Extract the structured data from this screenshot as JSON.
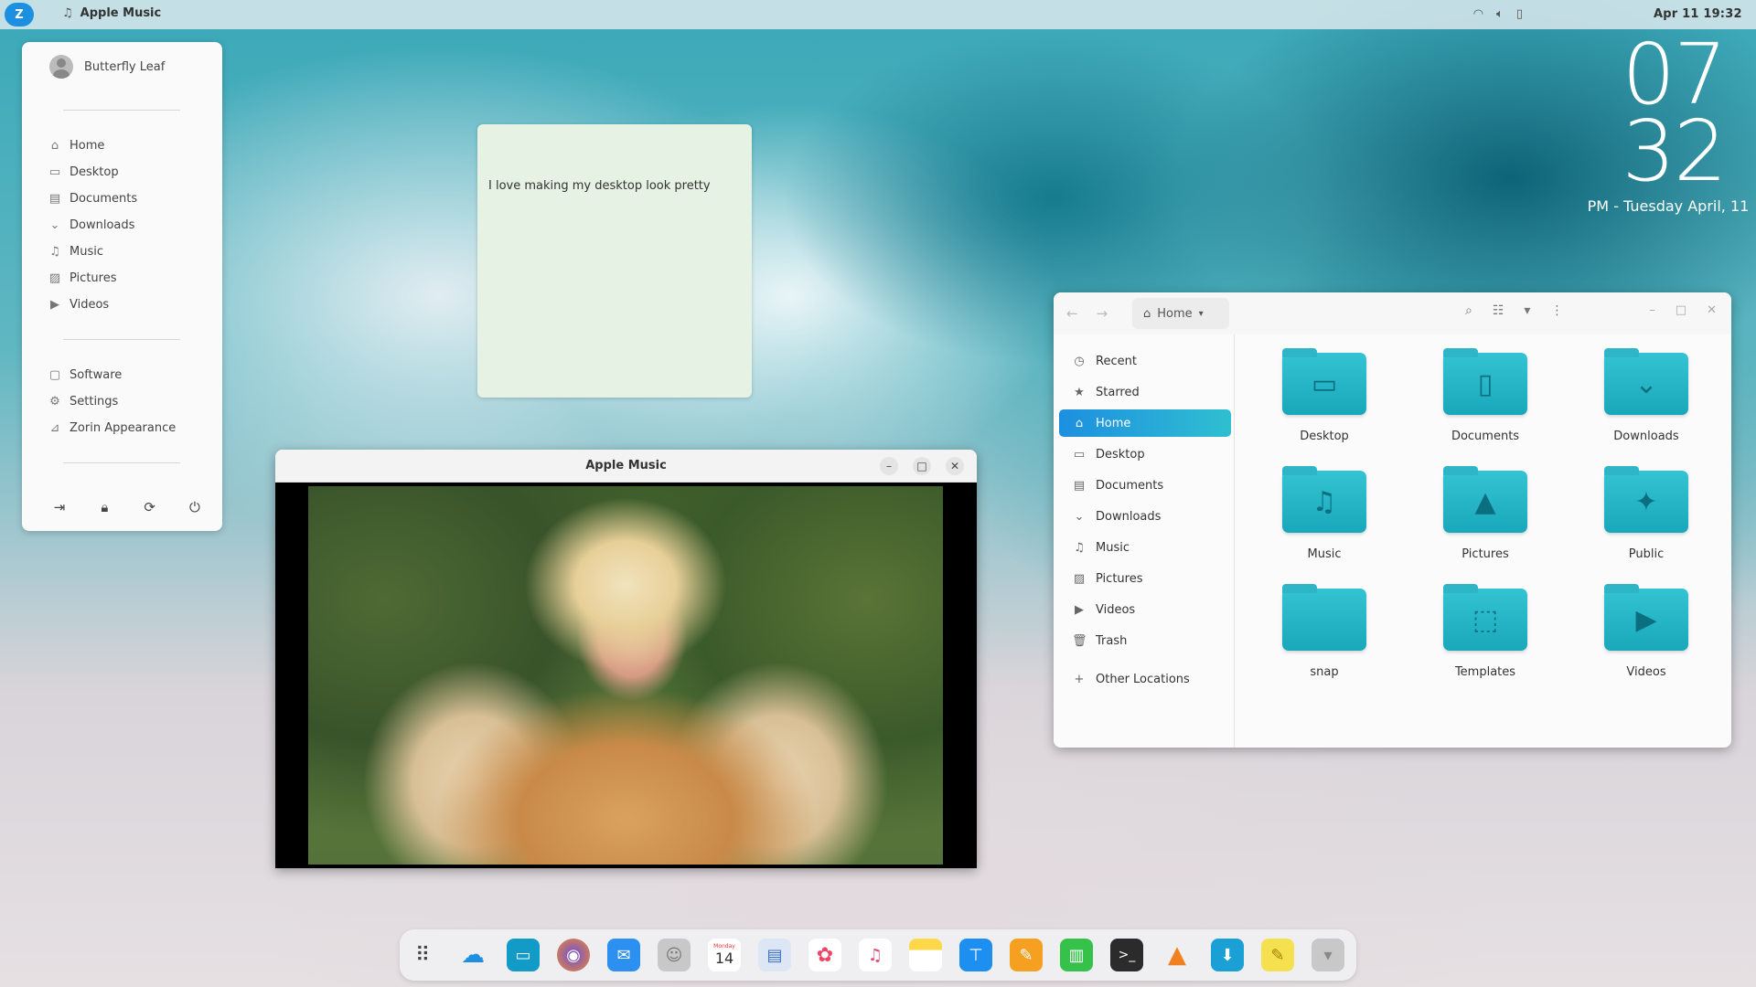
{
  "topbar": {
    "app_name": "Apple Music",
    "app_icon": "music-note-icon",
    "time": "Apr 11  19:32",
    "tray_icons": [
      "wifi-icon",
      "volume-icon",
      "battery-icon"
    ]
  },
  "desktop_clock": {
    "hour": "07",
    "minute": "32",
    "date": "PM - Tuesday April, 11"
  },
  "start_menu": {
    "user_name": "Butterfly Leaf",
    "places": [
      {
        "label": "Home",
        "icon": "home-icon"
      },
      {
        "label": "Desktop",
        "icon": "desktop-icon"
      },
      {
        "label": "Documents",
        "icon": "documents-icon"
      },
      {
        "label": "Downloads",
        "icon": "downloads-icon"
      },
      {
        "label": "Music",
        "icon": "music-icon"
      },
      {
        "label": "Pictures",
        "icon": "pictures-icon"
      },
      {
        "label": "Videos",
        "icon": "videos-icon"
      }
    ],
    "system": [
      {
        "label": "Software",
        "icon": "software-icon"
      },
      {
        "label": "Settings",
        "icon": "settings-icon"
      },
      {
        "label": "Zorin Appearance",
        "icon": "appearance-icon"
      }
    ],
    "actions": [
      "logout-icon",
      "lock-icon",
      "restart-icon",
      "power-icon"
    ]
  },
  "sticky_note": {
    "text": "I love making my desktop look pretty",
    "color": "#e6f2e3"
  },
  "music_window": {
    "title": "Apple Music"
  },
  "files": {
    "path_label": "Home",
    "sidebar": [
      {
        "label": "Recent",
        "icon": "recent-icon"
      },
      {
        "label": "Starred",
        "icon": "star-icon"
      },
      {
        "label": "Home",
        "icon": "home-icon"
      },
      {
        "label": "Desktop",
        "icon": "desktop-icon"
      },
      {
        "label": "Documents",
        "icon": "documents-icon"
      },
      {
        "label": "Downloads",
        "icon": "downloads-icon"
      },
      {
        "label": "Music",
        "icon": "music-icon"
      },
      {
        "label": "Pictures",
        "icon": "pictures-icon"
      },
      {
        "label": "Videos",
        "icon": "videos-icon"
      },
      {
        "label": "Trash",
        "icon": "trash-icon"
      },
      {
        "label": "Other Locations",
        "icon": "plus-icon"
      }
    ],
    "active_item": "Home",
    "folders": [
      {
        "label": "Desktop",
        "icon": "desktop-folder-icon"
      },
      {
        "label": "Documents",
        "icon": "documents-folder-icon"
      },
      {
        "label": "Downloads",
        "icon": "downloads-folder-icon"
      },
      {
        "label": "Music",
        "icon": "music-folder-icon"
      },
      {
        "label": "Pictures",
        "icon": "pictures-folder-icon"
      },
      {
        "label": "Public",
        "icon": "public-folder-icon"
      },
      {
        "label": "snap",
        "icon": "folder-icon"
      },
      {
        "label": "Templates",
        "icon": "templates-folder-icon"
      },
      {
        "label": "Videos",
        "icon": "videos-folder-icon"
      }
    ]
  },
  "dock": {
    "apps": [
      "app-grid-icon",
      "icloud-icon",
      "files-icon",
      "firefox-icon",
      "mail-icon",
      "contacts-icon",
      "calendar-icon",
      "document-viewer-icon",
      "photos-icon",
      "music-icon",
      "notes-icon",
      "keynote-icon",
      "pages-icon",
      "numbers-icon",
      "terminal-icon",
      "vlc-icon",
      "software-icon",
      "sticky-notes-icon",
      "trash-icon"
    ],
    "calendar_day_label": "Monday",
    "calendar_day": "14"
  },
  "colors": {
    "accent": "#1d8fe0",
    "folder": "#18a8bb"
  }
}
